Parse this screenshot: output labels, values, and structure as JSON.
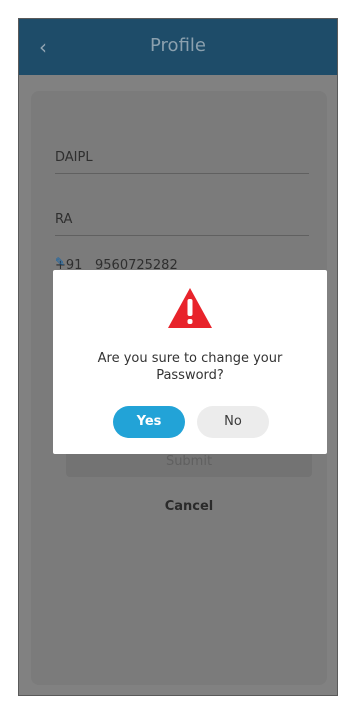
{
  "appbar": {
    "title": "Profile",
    "back_icon": "chevron-left-icon"
  },
  "form": {
    "first_field_value": "DAIPL",
    "second_field_value": "RA",
    "phone_prefix": "+91",
    "phone_number": "9560725282",
    "submit_label": "Submit",
    "cancel_label": "Cancel"
  },
  "dialog": {
    "icon": "warning-triangle-icon",
    "message": "Are you sure to change your Password?",
    "yes_label": "Yes",
    "no_label": "No"
  },
  "colors": {
    "appbar": "#1e4c69",
    "dialog_yes": "#22a3d7",
    "warning_red": "#e8232b"
  }
}
